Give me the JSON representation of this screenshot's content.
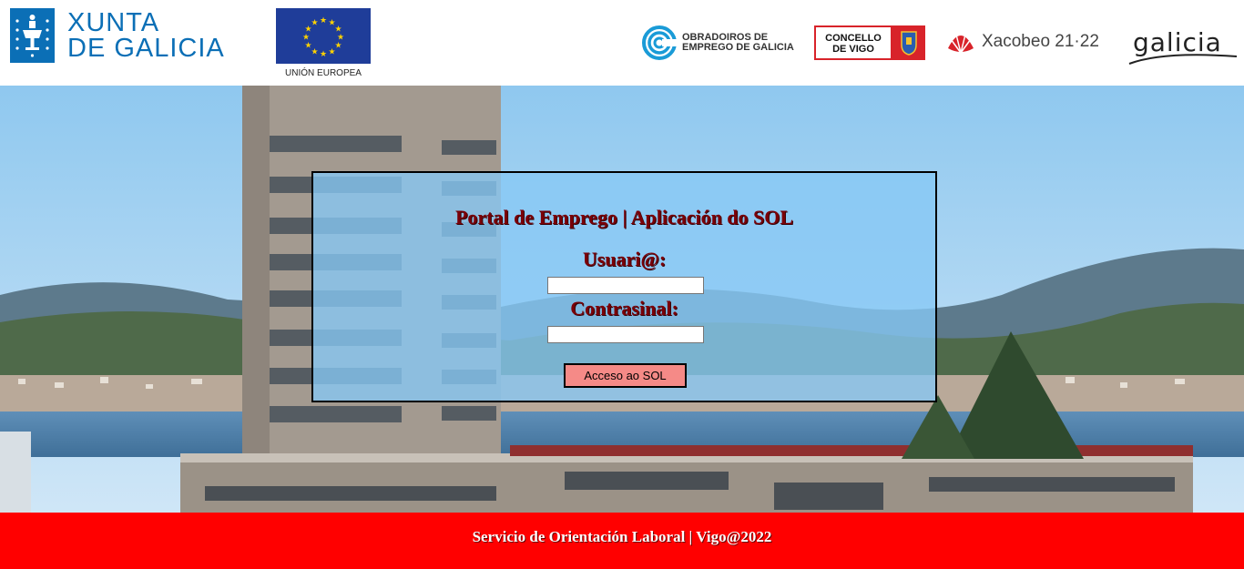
{
  "header": {
    "xunta_logo": {
      "line1": "XUNTA",
      "line2": "DE GALICIA",
      "icon": "xunta-crest-icon"
    },
    "eu_logo": {
      "caption": "UNIÓN EUROPEA",
      "icon": "eu-flag-icon"
    },
    "obradoiros_logo": {
      "line1": "OBRADOIROS DE",
      "line2": "EMPREGO DE GALICIA",
      "icon": "obradoiros-swirl-icon"
    },
    "concello_logo": {
      "line1": "CONCELLO",
      "line2": "DE VIGO",
      "icon": "vigo-shield-icon"
    },
    "xacobeo_logo": {
      "text": "Xacobeo 21·22",
      "icon": "scallop-shell-icon"
    },
    "galicia_logo": {
      "text": "galicia"
    }
  },
  "login": {
    "title": "Portal de Emprego | Aplicación do SOL",
    "user_label": "Usuari@:",
    "user_value": "",
    "password_label": "Contrasinal:",
    "password_value": "",
    "submit_label": "Acceso ao SOL"
  },
  "footer": {
    "text": "Servicio de Orientación Laboral | Vigo@2022"
  },
  "colors": {
    "accent_red": "#ff0000",
    "title_maroon": "#7a0008",
    "button_pink": "#f58a87",
    "xunta_blue": "#0b6fb6",
    "eu_blue": "#1f3d99"
  }
}
